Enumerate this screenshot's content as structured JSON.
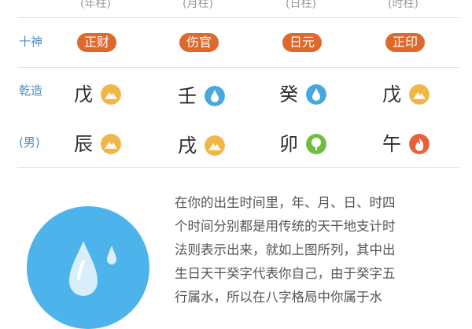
{
  "clipped_top_labels": [
    "(年柱)",
    "(月柱)",
    "(日柱)",
    "(时柱)"
  ],
  "rows": {
    "shishen": {
      "label": "十神",
      "items": [
        "正财",
        "伤官",
        "日元",
        "正印"
      ]
    },
    "tiangan": {
      "label": "乾造",
      "chars": [
        "戊",
        "壬",
        "癸",
        "戊"
      ],
      "elements": [
        "earth-icon",
        "water-icon",
        "water-icon",
        "earth-icon"
      ]
    },
    "dizhi": {
      "label": "(男)",
      "chars": [
        "辰",
        "戌",
        "卯",
        "午"
      ],
      "elements": [
        "earth-icon",
        "earth-icon",
        "wood-icon",
        "fire-icon"
      ]
    }
  },
  "colors": {
    "badge": "#dd6a2c",
    "label": "#4f8fc4",
    "earth": "#f0b646",
    "water": "#46a8df",
    "wood": "#6cbf3c",
    "fire": "#e8603a",
    "divider": "#cfe3ee",
    "hero_circle": "#4cb4ea"
  },
  "description": {
    "hero_icon": "water-drop-icon",
    "lines": [
      "在你的出生时间里，年、月、日、时四",
      "个时间分别都是用传统的天干地支计时",
      "法则表示出来，就如上图所列，其中出",
      "生日天干癸字代表你自己，由于癸字五",
      "行属水，所以在八字格局中你属于水"
    ]
  }
}
